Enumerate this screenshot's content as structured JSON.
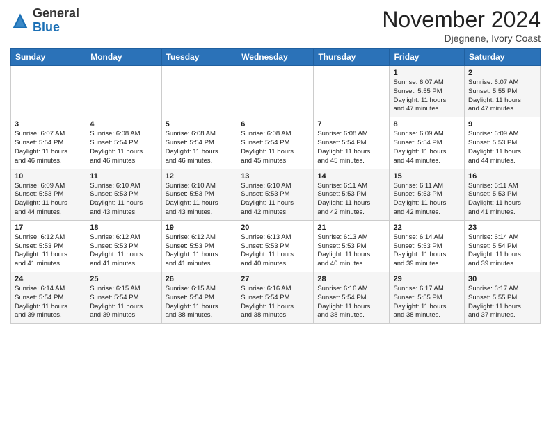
{
  "header": {
    "logo_general": "General",
    "logo_blue": "Blue",
    "month_title": "November 2024",
    "location": "Djegnene, Ivory Coast"
  },
  "days_of_week": [
    "Sunday",
    "Monday",
    "Tuesday",
    "Wednesday",
    "Thursday",
    "Friday",
    "Saturday"
  ],
  "weeks": [
    [
      {
        "day": "",
        "info": ""
      },
      {
        "day": "",
        "info": ""
      },
      {
        "day": "",
        "info": ""
      },
      {
        "day": "",
        "info": ""
      },
      {
        "day": "",
        "info": ""
      },
      {
        "day": "1",
        "info": "Sunrise: 6:07 AM\nSunset: 5:55 PM\nDaylight: 11 hours\nand 47 minutes."
      },
      {
        "day": "2",
        "info": "Sunrise: 6:07 AM\nSunset: 5:55 PM\nDaylight: 11 hours\nand 47 minutes."
      }
    ],
    [
      {
        "day": "3",
        "info": "Sunrise: 6:07 AM\nSunset: 5:54 PM\nDaylight: 11 hours\nand 46 minutes."
      },
      {
        "day": "4",
        "info": "Sunrise: 6:08 AM\nSunset: 5:54 PM\nDaylight: 11 hours\nand 46 minutes."
      },
      {
        "day": "5",
        "info": "Sunrise: 6:08 AM\nSunset: 5:54 PM\nDaylight: 11 hours\nand 46 minutes."
      },
      {
        "day": "6",
        "info": "Sunrise: 6:08 AM\nSunset: 5:54 PM\nDaylight: 11 hours\nand 45 minutes."
      },
      {
        "day": "7",
        "info": "Sunrise: 6:08 AM\nSunset: 5:54 PM\nDaylight: 11 hours\nand 45 minutes."
      },
      {
        "day": "8",
        "info": "Sunrise: 6:09 AM\nSunset: 5:54 PM\nDaylight: 11 hours\nand 44 minutes."
      },
      {
        "day": "9",
        "info": "Sunrise: 6:09 AM\nSunset: 5:53 PM\nDaylight: 11 hours\nand 44 minutes."
      }
    ],
    [
      {
        "day": "10",
        "info": "Sunrise: 6:09 AM\nSunset: 5:53 PM\nDaylight: 11 hours\nand 44 minutes."
      },
      {
        "day": "11",
        "info": "Sunrise: 6:10 AM\nSunset: 5:53 PM\nDaylight: 11 hours\nand 43 minutes."
      },
      {
        "day": "12",
        "info": "Sunrise: 6:10 AM\nSunset: 5:53 PM\nDaylight: 11 hours\nand 43 minutes."
      },
      {
        "day": "13",
        "info": "Sunrise: 6:10 AM\nSunset: 5:53 PM\nDaylight: 11 hours\nand 42 minutes."
      },
      {
        "day": "14",
        "info": "Sunrise: 6:11 AM\nSunset: 5:53 PM\nDaylight: 11 hours\nand 42 minutes."
      },
      {
        "day": "15",
        "info": "Sunrise: 6:11 AM\nSunset: 5:53 PM\nDaylight: 11 hours\nand 42 minutes."
      },
      {
        "day": "16",
        "info": "Sunrise: 6:11 AM\nSunset: 5:53 PM\nDaylight: 11 hours\nand 41 minutes."
      }
    ],
    [
      {
        "day": "17",
        "info": "Sunrise: 6:12 AM\nSunset: 5:53 PM\nDaylight: 11 hours\nand 41 minutes."
      },
      {
        "day": "18",
        "info": "Sunrise: 6:12 AM\nSunset: 5:53 PM\nDaylight: 11 hours\nand 41 minutes."
      },
      {
        "day": "19",
        "info": "Sunrise: 6:12 AM\nSunset: 5:53 PM\nDaylight: 11 hours\nand 41 minutes."
      },
      {
        "day": "20",
        "info": "Sunrise: 6:13 AM\nSunset: 5:53 PM\nDaylight: 11 hours\nand 40 minutes."
      },
      {
        "day": "21",
        "info": "Sunrise: 6:13 AM\nSunset: 5:53 PM\nDaylight: 11 hours\nand 40 minutes."
      },
      {
        "day": "22",
        "info": "Sunrise: 6:14 AM\nSunset: 5:53 PM\nDaylight: 11 hours\nand 39 minutes."
      },
      {
        "day": "23",
        "info": "Sunrise: 6:14 AM\nSunset: 5:54 PM\nDaylight: 11 hours\nand 39 minutes."
      }
    ],
    [
      {
        "day": "24",
        "info": "Sunrise: 6:14 AM\nSunset: 5:54 PM\nDaylight: 11 hours\nand 39 minutes."
      },
      {
        "day": "25",
        "info": "Sunrise: 6:15 AM\nSunset: 5:54 PM\nDaylight: 11 hours\nand 39 minutes."
      },
      {
        "day": "26",
        "info": "Sunrise: 6:15 AM\nSunset: 5:54 PM\nDaylight: 11 hours\nand 38 minutes."
      },
      {
        "day": "27",
        "info": "Sunrise: 6:16 AM\nSunset: 5:54 PM\nDaylight: 11 hours\nand 38 minutes."
      },
      {
        "day": "28",
        "info": "Sunrise: 6:16 AM\nSunset: 5:54 PM\nDaylight: 11 hours\nand 38 minutes."
      },
      {
        "day": "29",
        "info": "Sunrise: 6:17 AM\nSunset: 5:55 PM\nDaylight: 11 hours\nand 38 minutes."
      },
      {
        "day": "30",
        "info": "Sunrise: 6:17 AM\nSunset: 5:55 PM\nDaylight: 11 hours\nand 37 minutes."
      }
    ]
  ]
}
